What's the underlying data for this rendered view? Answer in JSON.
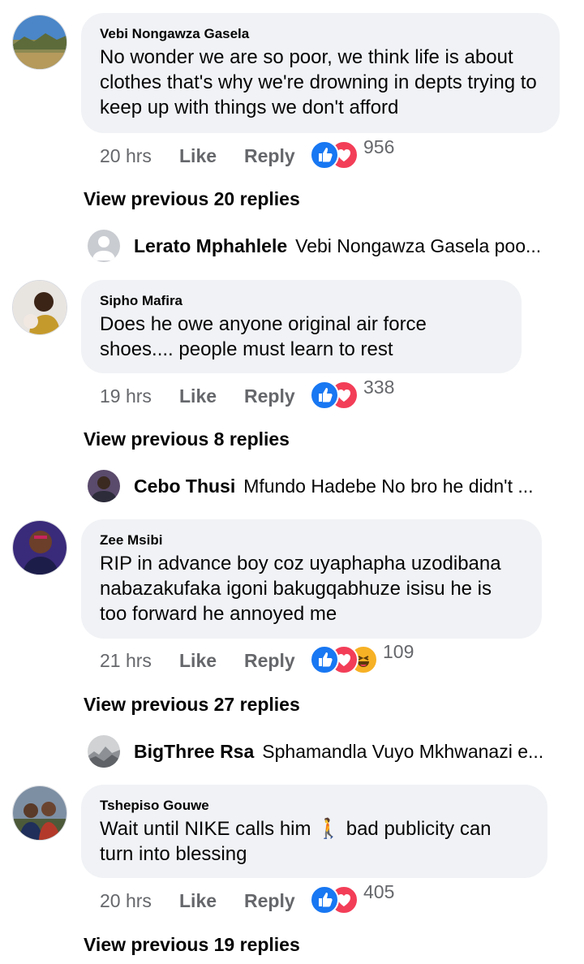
{
  "threads": [
    {
      "author": "Vebi Nongawza Gasela",
      "text": "No wonder we are so poor, we think life is about clothes that's why we're drowning in depts trying to keep up with things we don't afford",
      "time": "20 hrs",
      "like_label": "Like",
      "reply_label": "Reply",
      "reactions": [
        "like",
        "love"
      ],
      "reaction_count": "956",
      "view_previous": "View previous 20 replies",
      "latest_reply": {
        "author": "Lerato Mphahlele",
        "preview": "Vebi Nongawza Gasela poo..."
      }
    },
    {
      "author": "Sipho Mafira",
      "text": "Does he owe anyone original air force shoes.... people must learn to rest",
      "time": "19 hrs",
      "like_label": "Like",
      "reply_label": "Reply",
      "reactions": [
        "like",
        "love"
      ],
      "reaction_count": "338",
      "view_previous": "View previous 8 replies",
      "latest_reply": {
        "author": "Cebo Thusi",
        "preview": "Mfundo Hadebe No bro he didn't ..."
      }
    },
    {
      "author": "Zee Msibi",
      "text": "RIP in advance boy coz uyaphapha uzodibana nabazakufaka igoni bakugqabhuze isisu he is too forward he annoyed me",
      "time": "21 hrs",
      "like_label": "Like",
      "reply_label": "Reply",
      "reactions": [
        "like",
        "love",
        "haha"
      ],
      "reaction_count": "109",
      "view_previous": "View previous 27 replies",
      "latest_reply": {
        "author": "BigThree Rsa",
        "preview": "Sphamandla Vuyo Mkhwanazi e..."
      }
    },
    {
      "author": "Tshepiso Gouwe",
      "text": "Wait until NIKE calls him 🚶 bad publicity can turn into blessing",
      "time": "20 hrs",
      "like_label": "Like",
      "reply_label": "Reply",
      "reactions": [
        "like",
        "love"
      ],
      "reaction_count": "405",
      "view_previous": "View previous 19 replies"
    }
  ],
  "colors": {
    "like_blue": "#1877f2",
    "love_red": "#f33e58",
    "haha_yellow": "#f7b125",
    "bubble_bg": "#f0f2f5",
    "meta_gray": "#65676b"
  }
}
